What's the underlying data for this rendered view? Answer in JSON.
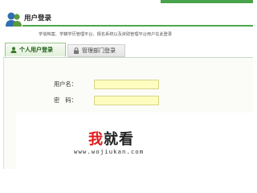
{
  "header": {
    "title": "用户登录",
    "subtitle": "学信档案、学籍学历管理平台、报名系统以及资助管理平台用户在此登录"
  },
  "tabs": [
    {
      "label": "个人用户登录",
      "icon": "user-icon"
    },
    {
      "label": "管理部门登录",
      "icon": "lock-icon"
    }
  ],
  "form": {
    "username_label": "用户名：",
    "password_label": "密　码：",
    "username_value": "",
    "password_value": ""
  },
  "watermark": {
    "title_highlight": "我",
    "title_rest": "就看",
    "url": "www.wojiukan.com"
  },
  "colors": {
    "accent_green": "#4aa84b",
    "input_yellow": "#fffcc0",
    "watermark_red": "#e11b1b"
  }
}
